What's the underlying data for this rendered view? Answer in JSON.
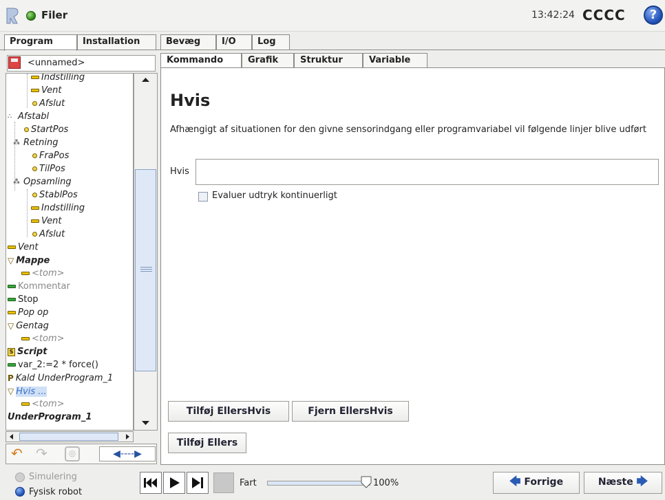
{
  "header": {
    "file_label": "Filer",
    "clock": "13:42:24",
    "robot_name": "CCCC",
    "help": "?"
  },
  "main_tabs": [
    "Program",
    "Installation",
    "Bevæg",
    "I/O",
    "Log"
  ],
  "program": {
    "name": "<unnamed>"
  },
  "tree": [
    "Indstilling",
    "Vent",
    "Afslut",
    "Afstabl",
    "StartPos",
    "Retning",
    "FraPos",
    "TilPos",
    "Opsamling",
    "StablPos",
    "Indstilling",
    "Vent",
    "Afslut",
    "Vent",
    "Mappe",
    "<tom>",
    "Kommentar",
    "Stop",
    "Pop op",
    "Gentag",
    "<tom>",
    "Script",
    "var_2:=2 * force()",
    "Kald UnderProgram_1",
    "Hvis ...",
    "<tom>",
    "UnderProgram_1"
  ],
  "sub_tabs": [
    "Kommando",
    "Grafik",
    "Struktur",
    "Variable"
  ],
  "editor": {
    "heading": "Hvis",
    "description": "Afhængigt af situationen for den givne sensorindgang eller programvariabel vil følgende linjer blive udført",
    "expr_label": "Hvis",
    "expr_value": "",
    "checkbox_label": "Evaluer udtryk kontinuerligt",
    "checkbox_checked": false,
    "add_elseif": "Tilføj EllersHvis",
    "remove_elseif": "Fjern EllersHvis",
    "add_else": "Tilføj Ellers"
  },
  "footer": {
    "simulation": "Simulering",
    "physical": "Fysisk robot",
    "speed_label": "Fart",
    "speed_value": "100%",
    "speed_level": 1.0,
    "prev": "Forrige",
    "next": "Næste"
  },
  "colors": {
    "accent": "#2a5bb5",
    "selected_bg": "#cfe0f7"
  }
}
